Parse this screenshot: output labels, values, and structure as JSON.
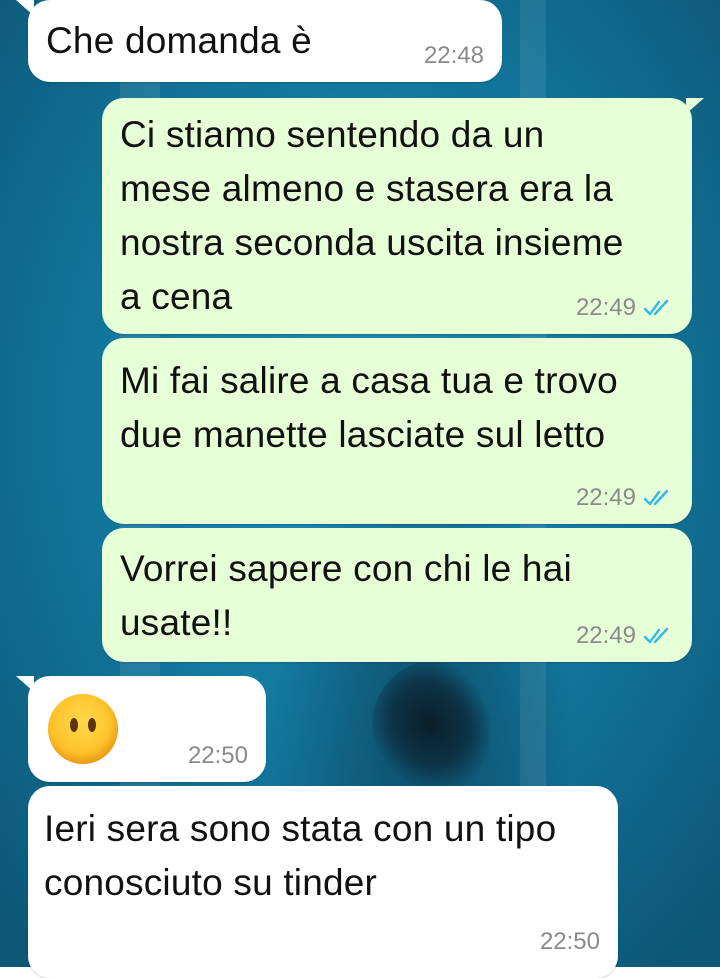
{
  "chat": {
    "messages": [
      {
        "direction": "incoming",
        "text": "Che domanda è",
        "time": "22:48"
      },
      {
        "direction": "outgoing",
        "text": "Ci stiamo sentendo da un mese almeno e stasera era la nostra seconda uscita insieme a cena",
        "time": "22:49",
        "status": "read"
      },
      {
        "direction": "outgoing",
        "text": "Mi fai salire a casa tua e trovo due manette lasciate sul letto",
        "time": "22:49",
        "status": "read"
      },
      {
        "direction": "outgoing",
        "text": "Vorrei sapere con chi le hai usate!!",
        "time": "22:49",
        "status": "read"
      },
      {
        "direction": "incoming",
        "emoji": "face-without-mouth",
        "time": "22:50"
      },
      {
        "direction": "incoming",
        "text": "Ieri sera sono stata con un tipo conosciuto su tinder",
        "time": "22:50"
      }
    ]
  },
  "colors": {
    "incoming_bubble": "#ffffff",
    "outgoing_bubble": "#e6ffd6",
    "read_ticks": "#34b7f1",
    "timestamp": "#8a8a8a"
  },
  "icons": {
    "read_status": "double-check-icon",
    "emoji": "face-without-mouth-emoji"
  }
}
